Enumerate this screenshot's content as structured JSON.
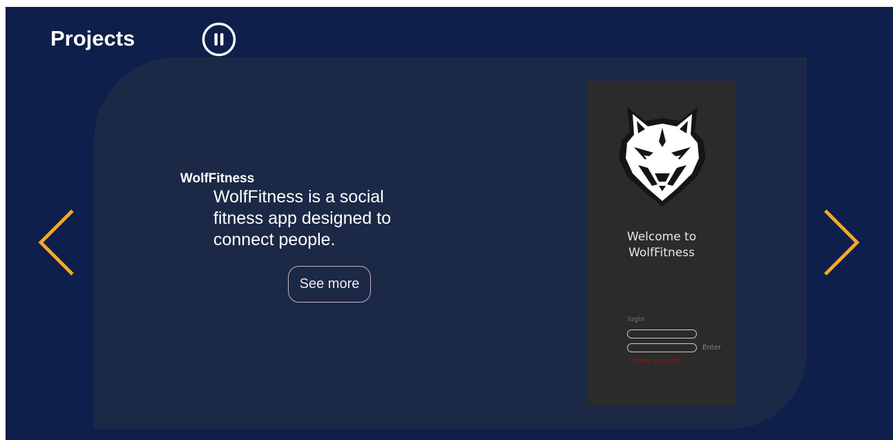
{
  "header": {
    "title": "Projects",
    "pause_icon": "pause-circle-icon"
  },
  "carousel": {
    "prev_icon": "chevron-left-icon",
    "next_icon": "chevron-right-icon",
    "accent_color": "#f0a830"
  },
  "project": {
    "name": "WolfFitness",
    "description": "WolfFitness is a social fitness app designed to connect people.",
    "see_more_label": "See more",
    "preview": {
      "logo_icon": "wolf-head-icon",
      "welcome_line1": "Welcome to",
      "welcome_line2": "WolfFitness",
      "login_label": "login",
      "enter_label": "Enter",
      "create_account_label": "Create account"
    }
  },
  "colors": {
    "background": "#0d1f4a",
    "card": "#1b2946",
    "phone": "#2b2b2b"
  }
}
